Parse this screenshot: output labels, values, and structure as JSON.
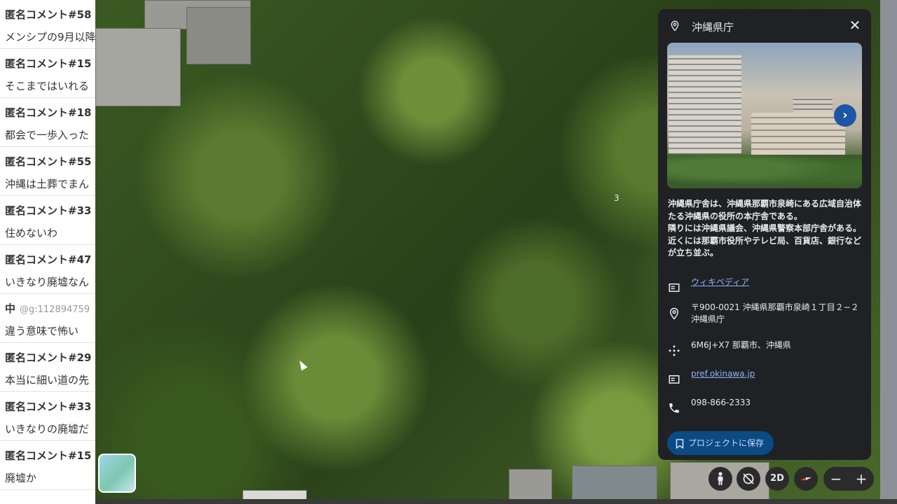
{
  "comments": [
    {
      "name": "匿名コメント#58",
      "id": "",
      "text": "メンシプの9月以降"
    },
    {
      "name": "匿名コメント#15",
      "id": "",
      "text": "そこまではいれる"
    },
    {
      "name": "匿名コメント#18",
      "id": "",
      "text": "都会で一歩入った"
    },
    {
      "name": "匿名コメント#55",
      "id": "",
      "text": "沖縄は土葬でまん"
    },
    {
      "name": "匿名コメント#33",
      "id": "",
      "text": "住めないわ"
    },
    {
      "name": "匿名コメント#47",
      "id": "",
      "text": "いきなり廃墟なん"
    },
    {
      "name": "中",
      "id": "@g:112894759",
      "text": "違う意味で怖い"
    },
    {
      "name": "匿名コメント#29",
      "id": "",
      "text": "本当に細い道の先"
    },
    {
      "name": "匿名コメント#33",
      "id": "",
      "text": "いきなりの廃墟だ"
    },
    {
      "name": "匿名コメント#15",
      "id": "",
      "text": "廃墟か"
    }
  ],
  "map": {
    "label": "3"
  },
  "panel": {
    "title": "沖縄県庁",
    "close": "✕",
    "photo_next": "›",
    "description": "沖縄県庁舎は、沖縄県那覇市泉崎にある広域自治体たる沖縄県の役所の本庁舎である。\n隣りには沖縄県議会、沖縄県警察本部庁舎がある。近くには那覇市役所やテレビ局、百貨店、銀行などが立ち並ぶ。",
    "wikipedia": "ウィキペディア",
    "address": "〒900-0021 沖縄県那覇市泉崎１丁目２−２ 沖縄県庁",
    "plus_code": "6M6J+X7 那覇市、沖縄県",
    "website": "pref.okinawa.jp",
    "phone": "098-866-2333",
    "save_button": "プロジェクトに保存"
  },
  "controls": {
    "mode_2d": "2D",
    "zoom_out": "−",
    "zoom_in": "+"
  },
  "colors": {
    "panel_bg": "#202124",
    "link": "#8ab4f8",
    "save_button_bg": "#0b4a82",
    "photo_next_bg": "#1a56a4"
  },
  "icons": {
    "header": "place-pin-icon",
    "wikipedia": "article-icon",
    "address": "place-pin-icon",
    "plus_code": "plus-code-icon",
    "website": "website-icon",
    "phone": "phone-icon",
    "save": "bookmark-icon",
    "pegman": "pegman-icon",
    "rotate": "rotate-disabled-icon",
    "compass": "compass-icon"
  }
}
